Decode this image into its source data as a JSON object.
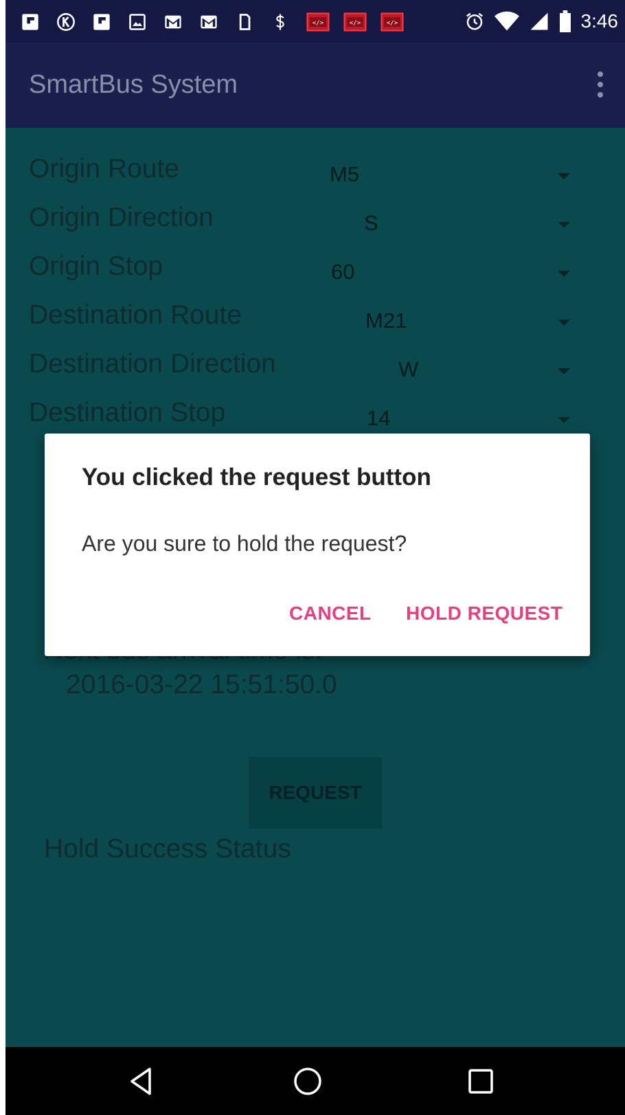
{
  "status_bar": {
    "time": "3:46",
    "notification_icons": [
      "flipboard-icon",
      "k-icon",
      "flipboard-icon",
      "image-icon",
      "gmail-icon",
      "gmail-icon",
      "phone-icon",
      "dollar-icon",
      "dev-icon",
      "dev-icon",
      "dev-icon"
    ],
    "system_icons": [
      "alarm-icon",
      "wifi-icon",
      "signal-icon",
      "battery-icon"
    ]
  },
  "app_bar": {
    "title": "SmartBus System"
  },
  "form": {
    "rows": [
      {
        "label": "Origin Route",
        "value": "M5"
      },
      {
        "label": "Origin Direction",
        "value": "S"
      },
      {
        "label": "Origin Stop",
        "value": "60"
      },
      {
        "label": "Destination Route",
        "value": "M21"
      },
      {
        "label": "Destination Direction",
        "value": "W"
      },
      {
        "label": "Destination Stop",
        "value": "14"
      }
    ]
  },
  "next_bus": {
    "label": "Next bus arrival time is:",
    "time": "2016-03-22 15:51:50.0"
  },
  "request_button": "REQUEST",
  "hold_status": "Hold Success Status",
  "dialog": {
    "title": "You clicked the request button",
    "message": "Are you sure to hold the request?",
    "cancel": "CANCEL",
    "confirm": "HOLD REQUEST"
  },
  "colors": {
    "status_bar": "#141843",
    "app_bar": "#1a1f4d",
    "content_bg": "#0a4a4f",
    "dialog_button": "#e83d82"
  }
}
